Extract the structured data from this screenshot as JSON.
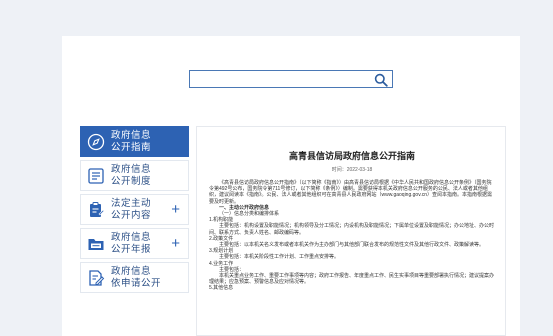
{
  "search": {
    "placeholder": ""
  },
  "sidebar": {
    "items": [
      {
        "line1": "政府信息",
        "line2": "公开指南",
        "active": true,
        "icon": "compass-icon",
        "has_plus": false
      },
      {
        "line1": "政府信息",
        "line2": "公开制度",
        "active": false,
        "icon": "document-list-icon",
        "has_plus": false
      },
      {
        "line1": "法定主动",
        "line2": "公开内容",
        "active": false,
        "icon": "clipboard-edit-icon",
        "has_plus": true
      },
      {
        "line1": "政府信息",
        "line2": "公开年报",
        "active": false,
        "icon": "folder-icon",
        "has_plus": true
      },
      {
        "line1": "政府信息",
        "line2": "依申请公开",
        "active": false,
        "icon": "edit-document-icon",
        "has_plus": false
      }
    ],
    "plus_label": "+"
  },
  "document": {
    "title": "高青县信访局政府信息公开指南",
    "date": "时间：2022-03-18",
    "paragraphs": [
      "《高青县信访局政府信息公开指南》（以下简称《指南》）由高青县信访局根据《中华人民共和国政府信息公开条例》（国务院令第492号公布，国务院令第711号修订，以下简称《条例》）编制。需要获得本机关政府信息公开服务的公民、法人或者其他组织，建议阅读本《指南》。公民、法人或者其他组织可在高青县人民政府网站（www.gaoqing.gov.cn）查阅本指南。本指南根据需要及时更新。",
      "一、主动公开政府信息",
      "（一）信息分类和编排体系",
      "1.机构职能",
      "主要包括：机构设置及职能情况；机构领导及分工情况；内设机构及职能情况；下属单位设置及职能情况；办公地址、办公时间、联系方式、负责人姓名、邮政编码等。",
      "2.政策文件",
      "主要包括：以本机关名义发布或者本机关作为主办部门与其他部门联合发布的规范性文件及其他行政文件、政策解读等。",
      "3.规划计划",
      "主要包括：本机关阶段性工作计划、工作重点安排等。",
      "4.业务工作",
      "主要包括：",
      "本机关重点业务工作、重要工作事项等内容；政府工作报告、年度重点工作、民生实事项目等重要部署执行情况；建议提案办理结果；应急预案、预警信息及应对情况等。",
      "5.其他信息"
    ]
  }
}
